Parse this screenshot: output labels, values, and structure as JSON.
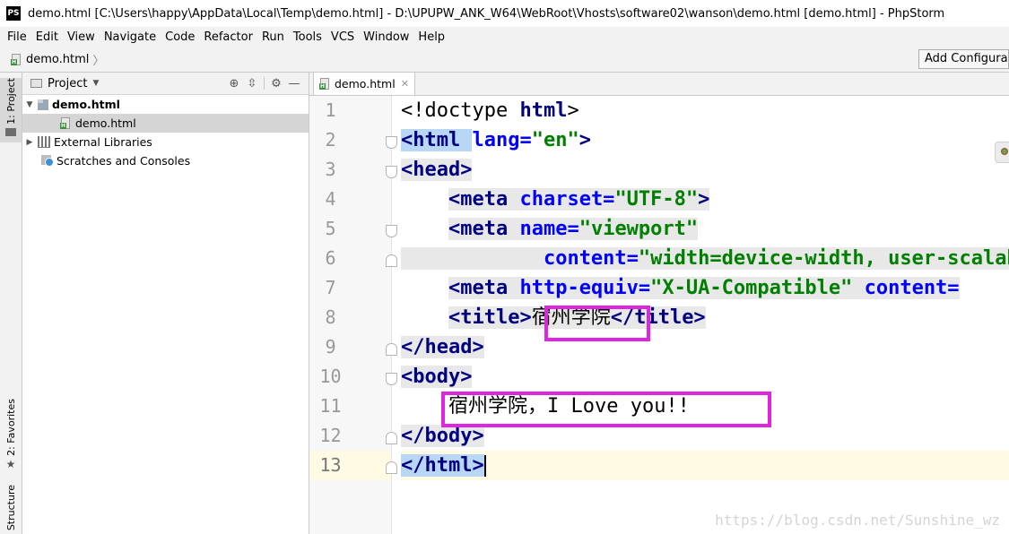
{
  "app": {
    "logo_text": "PS",
    "title": "demo.html [C:\\Users\\happy\\AppData\\Local\\Temp\\demo.html] - D:\\UPUPW_ANK_W64\\WebRoot\\Vhosts\\software02\\wanson\\demo.html [demo.html] - PhpStorm"
  },
  "menu": [
    "File",
    "Edit",
    "View",
    "Navigate",
    "Code",
    "Refactor",
    "Run",
    "Tools",
    "VCS",
    "Window",
    "Help"
  ],
  "navbar": {
    "breadcrumb": "demo.html",
    "add_config": "Add Configuration..."
  },
  "stripe": {
    "project": "1: Project",
    "favorites": "2: Favorites",
    "structure": "Structure"
  },
  "project_panel": {
    "title": "Project",
    "tree": {
      "root": "demo.html",
      "child": "demo.html",
      "external": "External Libraries",
      "scratches": "Scratches and Consoles"
    }
  },
  "editor": {
    "tab": "demo.html",
    "line_numbers": [
      "1",
      "2",
      "3",
      "4",
      "5",
      "6",
      "7",
      "8",
      "9",
      "10",
      "11",
      "12",
      "13"
    ],
    "current_line": 13,
    "code": {
      "l1_a": "<!doctype ",
      "l1_b": "html",
      "l1_c": ">",
      "l2_a": "<html ",
      "l2_b": "lang=",
      "l2_c": "\"en\"",
      "l2_d": ">",
      "l3": "<head>",
      "l4_a": "<meta ",
      "l4_b": "charset=",
      "l4_c": "\"UTF-8\"",
      "l4_d": ">",
      "l5_a": "<meta ",
      "l5_b": "name=",
      "l5_c": "\"viewport\"",
      "l6_a": "content=",
      "l6_b": "\"width=device-width, user-scalable=no\"",
      "l7_a": "<meta ",
      "l7_b": "http-equiv=",
      "l7_c": "\"X-UA-Compatible\"",
      "l7_d": " content=",
      "l8_a": "<title>",
      "l8_b": "宿州学院",
      "l8_c": "</title>",
      "l9": "</head>",
      "l10": "<body>",
      "l11": "宿州学院，I Love you!!",
      "l12": "</body>",
      "l13": "</html>"
    }
  },
  "watermark": "https://blog.csdn.net/Sunshine_wz",
  "colors": {
    "tag": "#000080",
    "attr": "#0000ff",
    "string": "#008000",
    "highlight_box": "#e025e0",
    "current_line": "#fffae3"
  }
}
